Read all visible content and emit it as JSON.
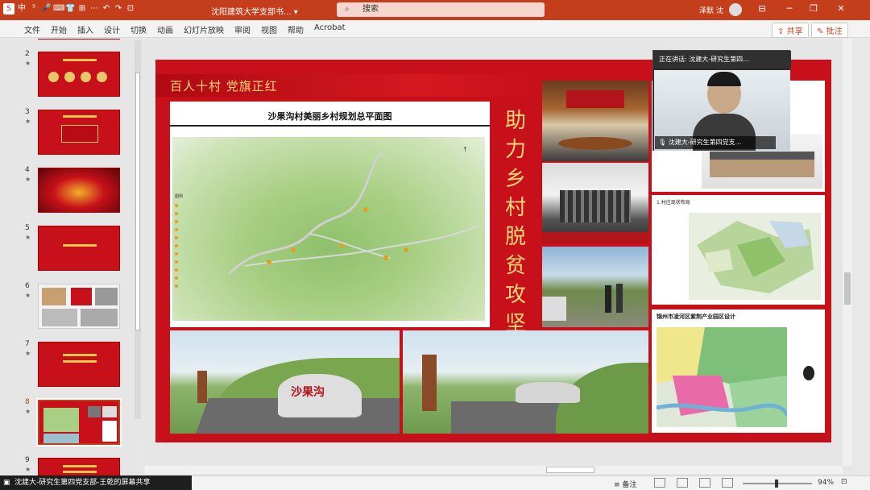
{
  "window": {
    "title": "沈阳建筑大学支部书...",
    "search_placeholder": "搜索",
    "user_name": "泽默 沈",
    "title_dropdown": "▾"
  },
  "quick_access": [
    "S",
    "中",
    "⁵",
    "🎤",
    "⌨",
    "👕",
    "⊞",
    "⋯",
    "↶",
    "↷",
    "⊡"
  ],
  "ribbon": {
    "tabs": [
      "文件",
      "开始",
      "插入",
      "设计",
      "切换",
      "动画",
      "幻灯片放映",
      "审阅",
      "视图",
      "帮助",
      "Acrobat"
    ],
    "share_label": "共享",
    "comment_label": "批注"
  },
  "thumbnails": [
    {
      "num": "2",
      "star": "★"
    },
    {
      "num": "3",
      "star": "★"
    },
    {
      "num": "4",
      "star": "★"
    },
    {
      "num": "5",
      "star": "★"
    },
    {
      "num": "6",
      "star": "★"
    },
    {
      "num": "7",
      "star": "★"
    },
    {
      "num": "8",
      "star": "★"
    },
    {
      "num": "9",
      "star": "★"
    }
  ],
  "slide": {
    "heading": "百人十村  党旗正红",
    "map_title": "沙果沟村美丽乡村规划总平面图",
    "legend_title": "图例",
    "vertical_text": "助力乡村脱贫攻坚",
    "rc2_title": "1.村庄现状布局",
    "rc3_title": "锦州市凌河区紫荆产业园区设计",
    "sign_text": "沙果沟"
  },
  "video": {
    "speaking_label": "正在讲话: 沈建大-研究生第四...",
    "participant_name": "沈建大-研究生第四党支..."
  },
  "statusbar": {
    "share_notice": "沈建大-研究生第四党支部-王乾的屏幕共享",
    "notes_label": "备注",
    "zoom": "94%"
  },
  "colors": {
    "accent": "#c43e1c",
    "slide_red": "#c8101a",
    "gold": "#f6d77a"
  }
}
